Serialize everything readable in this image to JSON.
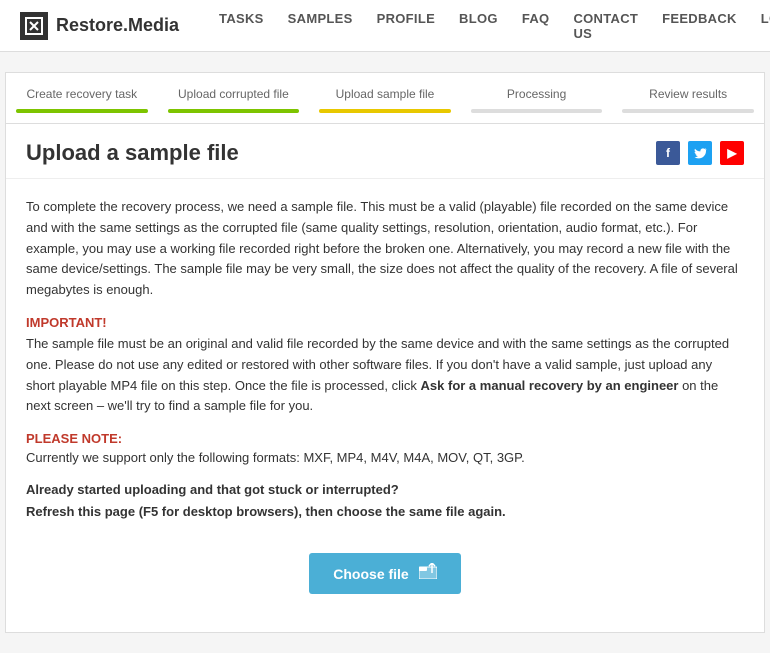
{
  "header": {
    "logo_text": "Restore.Media",
    "nav": [
      {
        "label": "TASKS",
        "id": "tasks"
      },
      {
        "label": "SAMPLES",
        "id": "samples"
      },
      {
        "label": "PROFILE",
        "id": "profile"
      },
      {
        "label": "BLOG",
        "id": "blog"
      },
      {
        "label": "FAQ",
        "id": "faq"
      },
      {
        "label": "CONTACT US",
        "id": "contact-us"
      },
      {
        "label": "FEEDBACK",
        "id": "feedback"
      },
      {
        "label": "LOGOUT",
        "id": "logout"
      }
    ]
  },
  "steps": [
    {
      "label": "Create recovery task",
      "bar": "green"
    },
    {
      "label": "Upload corrupted file",
      "bar": "green"
    },
    {
      "label": "Upload sample file",
      "bar": "yellow"
    },
    {
      "label": "Processing",
      "bar": "gray"
    },
    {
      "label": "Review results",
      "bar": "gray"
    }
  ],
  "page": {
    "title": "Upload a sample file",
    "social": [
      "f",
      "t",
      "▶"
    ],
    "description": "To complete the recovery process, we need a sample file. This must be a valid (playable) file recorded on the same device and with the same settings as the corrupted file (same quality settings, resolution, orientation, audio format, etc.). For example, you may use a working file recorded right before the broken one. Alternatively, you may record a new file with the same device/settings. The sample file may be very small, the size does not affect the quality of the recovery. A file of several megabytes is enough.",
    "important_label": "IMPORTANT!",
    "important_text_1": "The sample file must be an original and valid file recorded by the same device and with the same settings as the corrupted one. Please do not use any edited or restored with other software files. If you don't have a valid sample, just upload any short playable MP4 file on this step. Once the file is processed, click ",
    "important_link": "Ask for a manual recovery by an engineer",
    "important_text_2": " on the next screen – we'll try to find a sample file for you.",
    "note_label": "PLEASE NOTE:",
    "note_text": "Currently we support only the following formats: MXF, MP4, M4V, M4A, MOV, QT, 3GP.",
    "stuck_line1": "Already started uploading and that got stuck or interrupted?",
    "stuck_line2": "Refresh this page (F5 for desktop browsers), then choose the same file again.",
    "choose_file_label": "Choose file"
  }
}
